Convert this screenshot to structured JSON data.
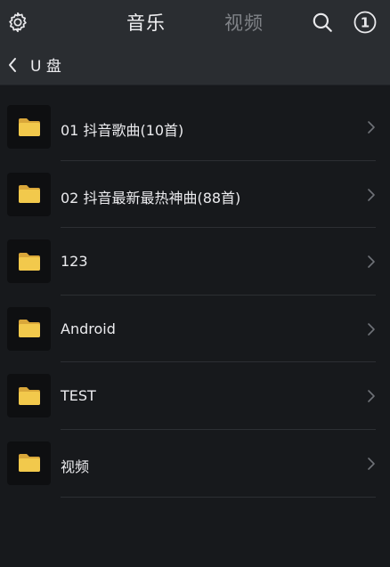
{
  "header": {
    "tabs": [
      {
        "label": "音乐",
        "active": true
      },
      {
        "label": "视频",
        "active": false
      }
    ],
    "icons": {
      "settings": "gear-icon",
      "search": "search-icon",
      "badge": "1"
    }
  },
  "subheader": {
    "title": "U 盘"
  },
  "folders": [
    {
      "label": "01 抖音歌曲(10首)"
    },
    {
      "label": "02 抖音最新最热神曲(88首)"
    },
    {
      "label": "123"
    },
    {
      "label": "Android"
    },
    {
      "label": "TEST"
    },
    {
      "label": "视频"
    }
  ],
  "colors": {
    "background": "#17191c",
    "bar": "#2a2d31",
    "folder": "#f2c94c",
    "inactive_tab": "#7f8287"
  }
}
